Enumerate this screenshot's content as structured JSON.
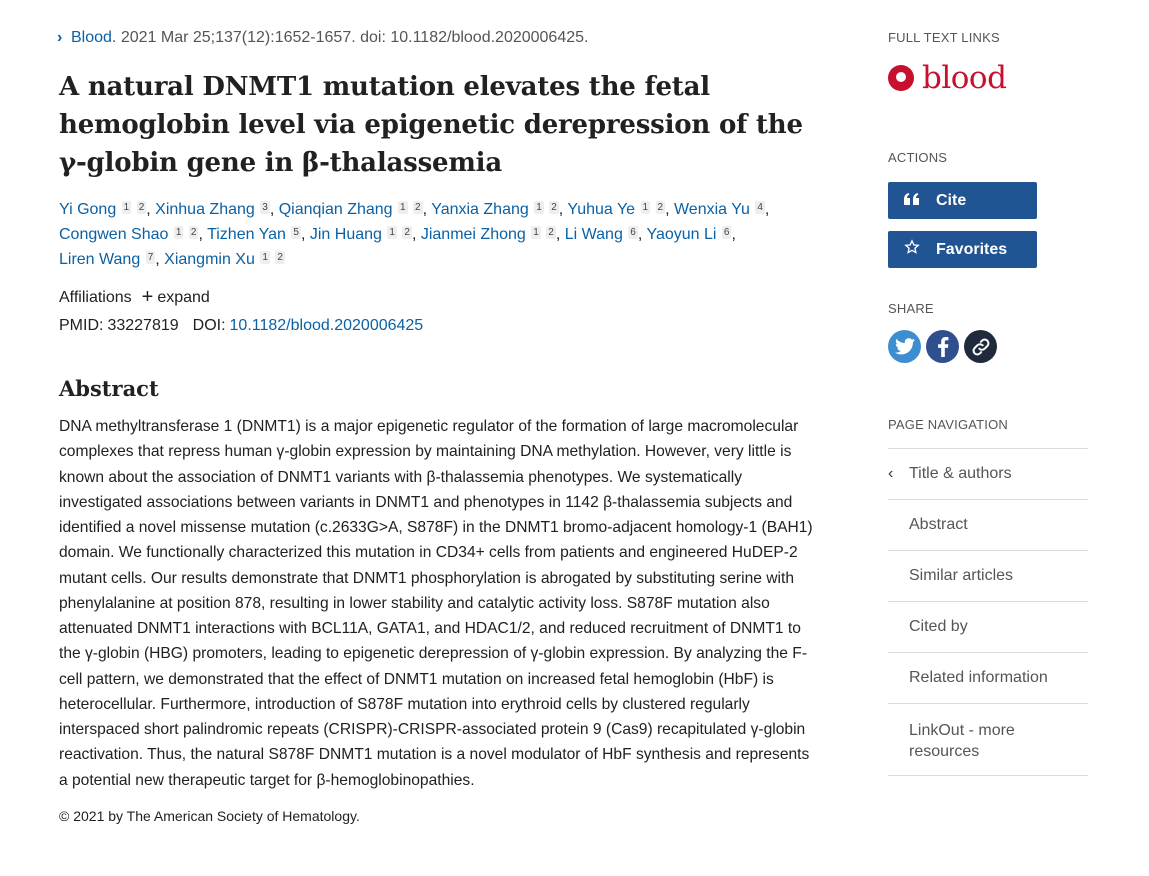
{
  "citation": {
    "journal": "Blood.",
    "details": "2021 Mar 25;137(12):1652-1657. doi: 10.1182/blood.2020006425."
  },
  "title": "A natural DNMT1 mutation elevates the fetal hemoglobin level via epigenetic derepression of the γ-globin gene in β-thalassemia",
  "authors": [
    {
      "name": "Yi Gong",
      "sups": [
        "1",
        "2"
      ]
    },
    {
      "name": "Xinhua Zhang",
      "sups": [
        "3"
      ]
    },
    {
      "name": "Qianqian Zhang",
      "sups": [
        "1",
        "2"
      ]
    },
    {
      "name": "Yanxia Zhang",
      "sups": [
        "1",
        "2"
      ]
    },
    {
      "name": "Yuhua Ye",
      "sups": [
        "1",
        "2"
      ]
    },
    {
      "name": "Wenxia Yu",
      "sups": [
        "4"
      ]
    },
    {
      "name": "Congwen Shao",
      "sups": [
        "1",
        "2"
      ]
    },
    {
      "name": "Tizhen Yan",
      "sups": [
        "5"
      ]
    },
    {
      "name": "Jin Huang",
      "sups": [
        "1",
        "2"
      ]
    },
    {
      "name": "Jianmei Zhong",
      "sups": [
        "1",
        "2"
      ]
    },
    {
      "name": "Li Wang",
      "sups": [
        "6"
      ]
    },
    {
      "name": "Yaoyun Li",
      "sups": [
        "6"
      ]
    },
    {
      "name": "Liren Wang",
      "sups": [
        "7"
      ]
    },
    {
      "name": "Xiangmin Xu",
      "sups": [
        "1",
        "2"
      ]
    }
  ],
  "affiliations": {
    "label": "Affiliations",
    "expand": "expand"
  },
  "ids": {
    "pmid_label": "PMID:",
    "pmid": "33227819",
    "doi_label": "DOI:",
    "doi": "10.1182/blood.2020006425"
  },
  "abstract": {
    "heading": "Abstract",
    "text": "DNA methyltransferase 1 (DNMT1) is a major epigenetic regulator of the formation of large macromolecular complexes that repress human γ-globin expression by maintaining DNA methylation. However, very little is known about the association of DNMT1 variants with β-thalassemia phenotypes. We systematically investigated associations between variants in DNMT1 and phenotypes in 1142 β-thalassemia subjects and identified a novel missense mutation (c.2633G>A, S878F) in the DNMT1 bromo-adjacent homology-1 (BAH1) domain. We functionally characterized this mutation in CD34+ cells from patients and engineered HuDEP-2 mutant cells. Our results demonstrate that DNMT1 phosphorylation is abrogated by substituting serine with phenylalanine at position 878, resulting in lower stability and catalytic activity loss. S878F mutation also attenuated DNMT1 interactions with BCL11A, GATA1, and HDAC1/2, and reduced recruitment of DNMT1 to the γ-globin (HBG) promoters, leading to epigenetic derepression of γ-globin expression. By analyzing the F-cell pattern, we demonstrated that the effect of DNMT1 mutation on increased fetal hemoglobin (HbF) is heterocellular. Furthermore, introduction of S878F mutation into erythroid cells by clustered regularly interspaced short palindromic repeats (CRISPR)-CRISPR-associated protein 9 (Cas9) recapitulated γ-globin reactivation. Thus, the natural S878F DNMT1 mutation is a novel modulator of HbF synthesis and represents a potential new therapeutic target for β-hemoglobinopathies.",
    "copyright": "© 2021 by The American Society of Hematology."
  },
  "sidebar": {
    "full_text_label": "FULL TEXT LINKS",
    "publisher_logo_text": "blood",
    "actions_label": "ACTIONS",
    "cite_label": "Cite",
    "favorites_label": "Favorites",
    "share_label": "SHARE",
    "share_icons": [
      "twitter-icon",
      "facebook-icon",
      "permalink-icon"
    ],
    "page_nav_label": "PAGE NAVIGATION",
    "nav_items": [
      "Title & authors",
      "Abstract",
      "Similar articles",
      "Cited by",
      "Related information",
      "LinkOut - more resources"
    ]
  },
  "colors": {
    "link": "#0b61a4",
    "button": "#205493",
    "publisher_red": "#c8102e",
    "twitter": "#3d8ed1",
    "facebook": "#2f4f8e",
    "permalink": "#1f2a3c"
  }
}
